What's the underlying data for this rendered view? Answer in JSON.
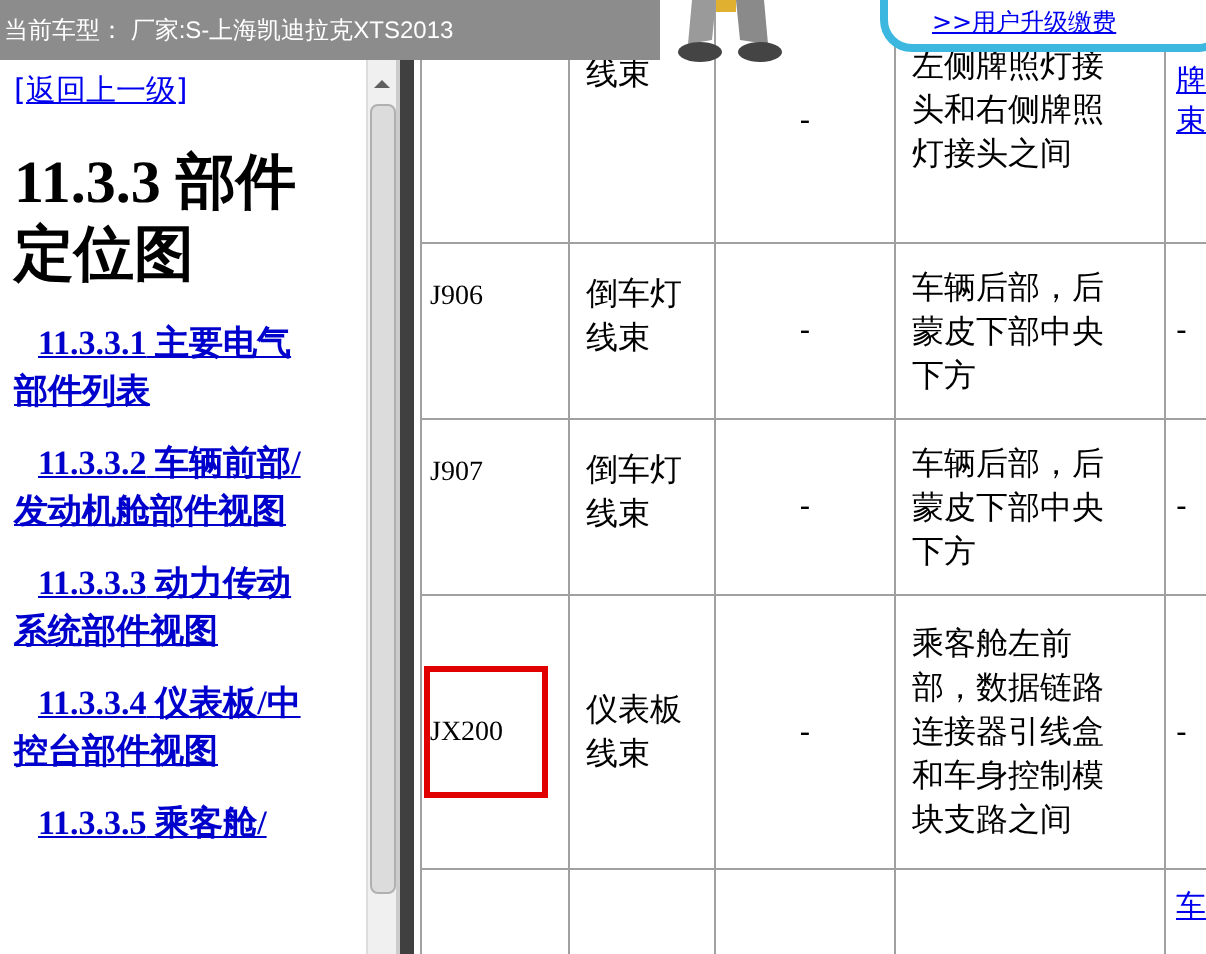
{
  "top_bar": {
    "text": "当前车型： 厂家:S-上海凯迪拉克XTS2013"
  },
  "promo": {
    "link": ">>用户升级缴费"
  },
  "sidebar": {
    "back_link": "[返回上一级]",
    "heading": "11.3.3 部件定位图",
    "links": [
      {
        "number": "11.3.3.1",
        "title": "主要电气部件列表"
      },
      {
        "number": "11.3.3.2",
        "title": "车辆前部/发动机舱部件视图"
      },
      {
        "number": "11.3.3.3",
        "title": "动力传动系统部件视图"
      },
      {
        "number": "11.3.3.4",
        "title": "仪表板/中控台部件视图"
      },
      {
        "number": "11.3.3.5",
        "title": "乘客舱/"
      }
    ]
  },
  "table": {
    "rows": [
      {
        "column_2": "线束",
        "column_3": "-",
        "column_4": "左侧牌照灯接头和右侧牌照灯接头之间",
        "column_5": "牌束",
        "column_5_link": true
      },
      {
        "column_1": "J906",
        "column_2": "倒车灯线束",
        "column_3": "-",
        "column_4": "车辆后部，后蒙皮下部中央下方",
        "column_5": "-",
        "column_5_link": false,
        "highlighted": false
      },
      {
        "column_1": "J907",
        "column_2": "倒车灯线束",
        "column_3": "-",
        "column_4": "车辆后部，后蒙皮下部中央下方",
        "column_5": "-",
        "column_5_link": false,
        "highlighted": false
      },
      {
        "column_1": "JX200",
        "column_2": "仪表板线束",
        "column_3": "-",
        "column_4": "乘客舱左前部，数据链路连接器引线盒和车身控制模块支路之间",
        "column_5": "-",
        "column_5_link": false,
        "highlighted": true
      },
      {
        "column_5": "车",
        "column_5_link": true
      }
    ]
  }
}
